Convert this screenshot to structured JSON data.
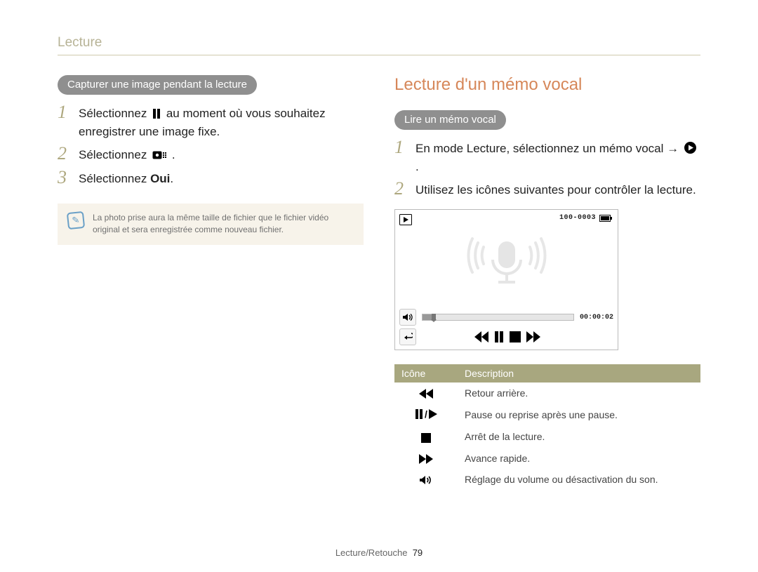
{
  "header": {
    "title": "Lecture"
  },
  "left": {
    "pill": "Capturer une image pendant la lecture",
    "steps": [
      {
        "num": "1",
        "pre": "Sélectionnez ",
        "post": " au moment où vous souhaitez enregistrer une image fixe.",
        "icon": "pause"
      },
      {
        "num": "2",
        "pre": "Sélectionnez ",
        "post": ".",
        "icon": "camera-box"
      },
      {
        "num": "3",
        "pre": "Sélectionnez ",
        "bold": "Oui",
        "post": "."
      }
    ],
    "note": "La photo prise aura la même taille de fichier que le fichier vidéo original et sera enregistrée comme nouveau fichier."
  },
  "right": {
    "title": "Lecture d'un mémo vocal",
    "pill": "Lire un mémo vocal",
    "steps": [
      {
        "num": "1",
        "pre": "En mode Lecture, sélectionnez un mémo vocal → ",
        "icon": "play-circle",
        "post": "."
      },
      {
        "num": "2",
        "text": "Utilisez les icônes suivantes pour contrôler la lecture."
      }
    ],
    "screen": {
      "file_counter": "100-0003",
      "time": "00:00:02",
      "progress_percent": 6
    },
    "table": {
      "headers": {
        "icon": "Icône",
        "desc": "Description"
      },
      "rows": [
        {
          "icon": "rewind",
          "desc": "Retour arrière."
        },
        {
          "icon": "pause-play",
          "desc": "Pause ou reprise après une pause."
        },
        {
          "icon": "stop",
          "desc": "Arrêt de la lecture."
        },
        {
          "icon": "forward",
          "desc": "Avance rapide."
        },
        {
          "icon": "volume",
          "desc": "Réglage du volume ou désactivation du son."
        }
      ]
    }
  },
  "footer": {
    "section": "Lecture/Retouche",
    "page": "79"
  }
}
